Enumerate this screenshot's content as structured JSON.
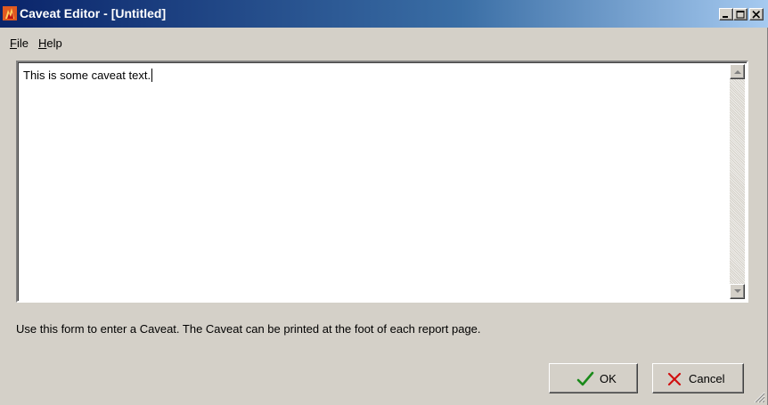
{
  "window": {
    "title": "Caveat Editor - [Untitled]",
    "controls": {
      "minimize_icon": "minimize-icon",
      "maximize_icon": "maximize-icon",
      "close_icon": "close-icon"
    },
    "title_gradient": [
      "#0a246a",
      "#a6caf0"
    ]
  },
  "menu": {
    "file": {
      "accel": "F",
      "rest": "ile"
    },
    "help": {
      "accel": "H",
      "rest": "elp"
    }
  },
  "editor": {
    "text": "This is some caveat text."
  },
  "info_text": "Use this form to enter a Caveat.  The Caveat can be printed at the foot of each report page.",
  "buttons": {
    "ok": {
      "label": "OK",
      "icon": "checkmark-icon",
      "icon_color": "#1a8a1a"
    },
    "cancel": {
      "label": "Cancel",
      "icon": "x-icon",
      "icon_color": "#d01010"
    }
  },
  "colors": {
    "face": "#d4d0c8",
    "title_text": "#ffffff"
  }
}
